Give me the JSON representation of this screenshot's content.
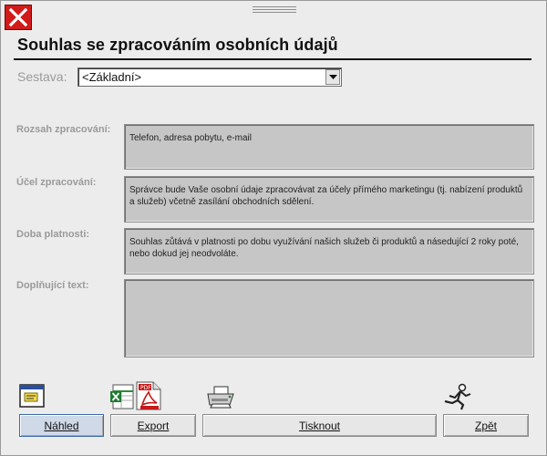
{
  "window": {
    "title": "Souhlas se zpracováním osobních údajů"
  },
  "report": {
    "label": "Sestava:",
    "selected": "<Základní>"
  },
  "fields": [
    {
      "label": "Rozsah zpracování:",
      "value": "Telefon, adresa pobytu, e-mail"
    },
    {
      "label": "Účel zpracování:",
      "value": "Správce bude Vaše osobní údaje zpracovávat za účely přímého marketingu (tj. nabízení produktů a služeb) včetně zasílání obchodních sdělení."
    },
    {
      "label": "Doba platnosti:",
      "value": "Souhlas zůtává v platnosti po dobu využívání našich služeb či produktů a násedující 2 roky poté, nebo dokud jej neodvoláte."
    },
    {
      "label": "Doplňující text:",
      "value": ""
    }
  ],
  "buttons": {
    "preview": "Náhled",
    "export": "Export",
    "print": "Tisknout",
    "back": "Zpět"
  },
  "icons": {
    "close": "close-icon",
    "preview": "window-preview-icon",
    "export_excel": "excel-icon",
    "export_pdf": "pdf-icon",
    "print": "printer-icon",
    "back": "running-man-icon"
  },
  "colors": {
    "close_red": "#d11b1b",
    "field_bg": "#c6c6c6",
    "label_gray": "#9a9a9a"
  }
}
